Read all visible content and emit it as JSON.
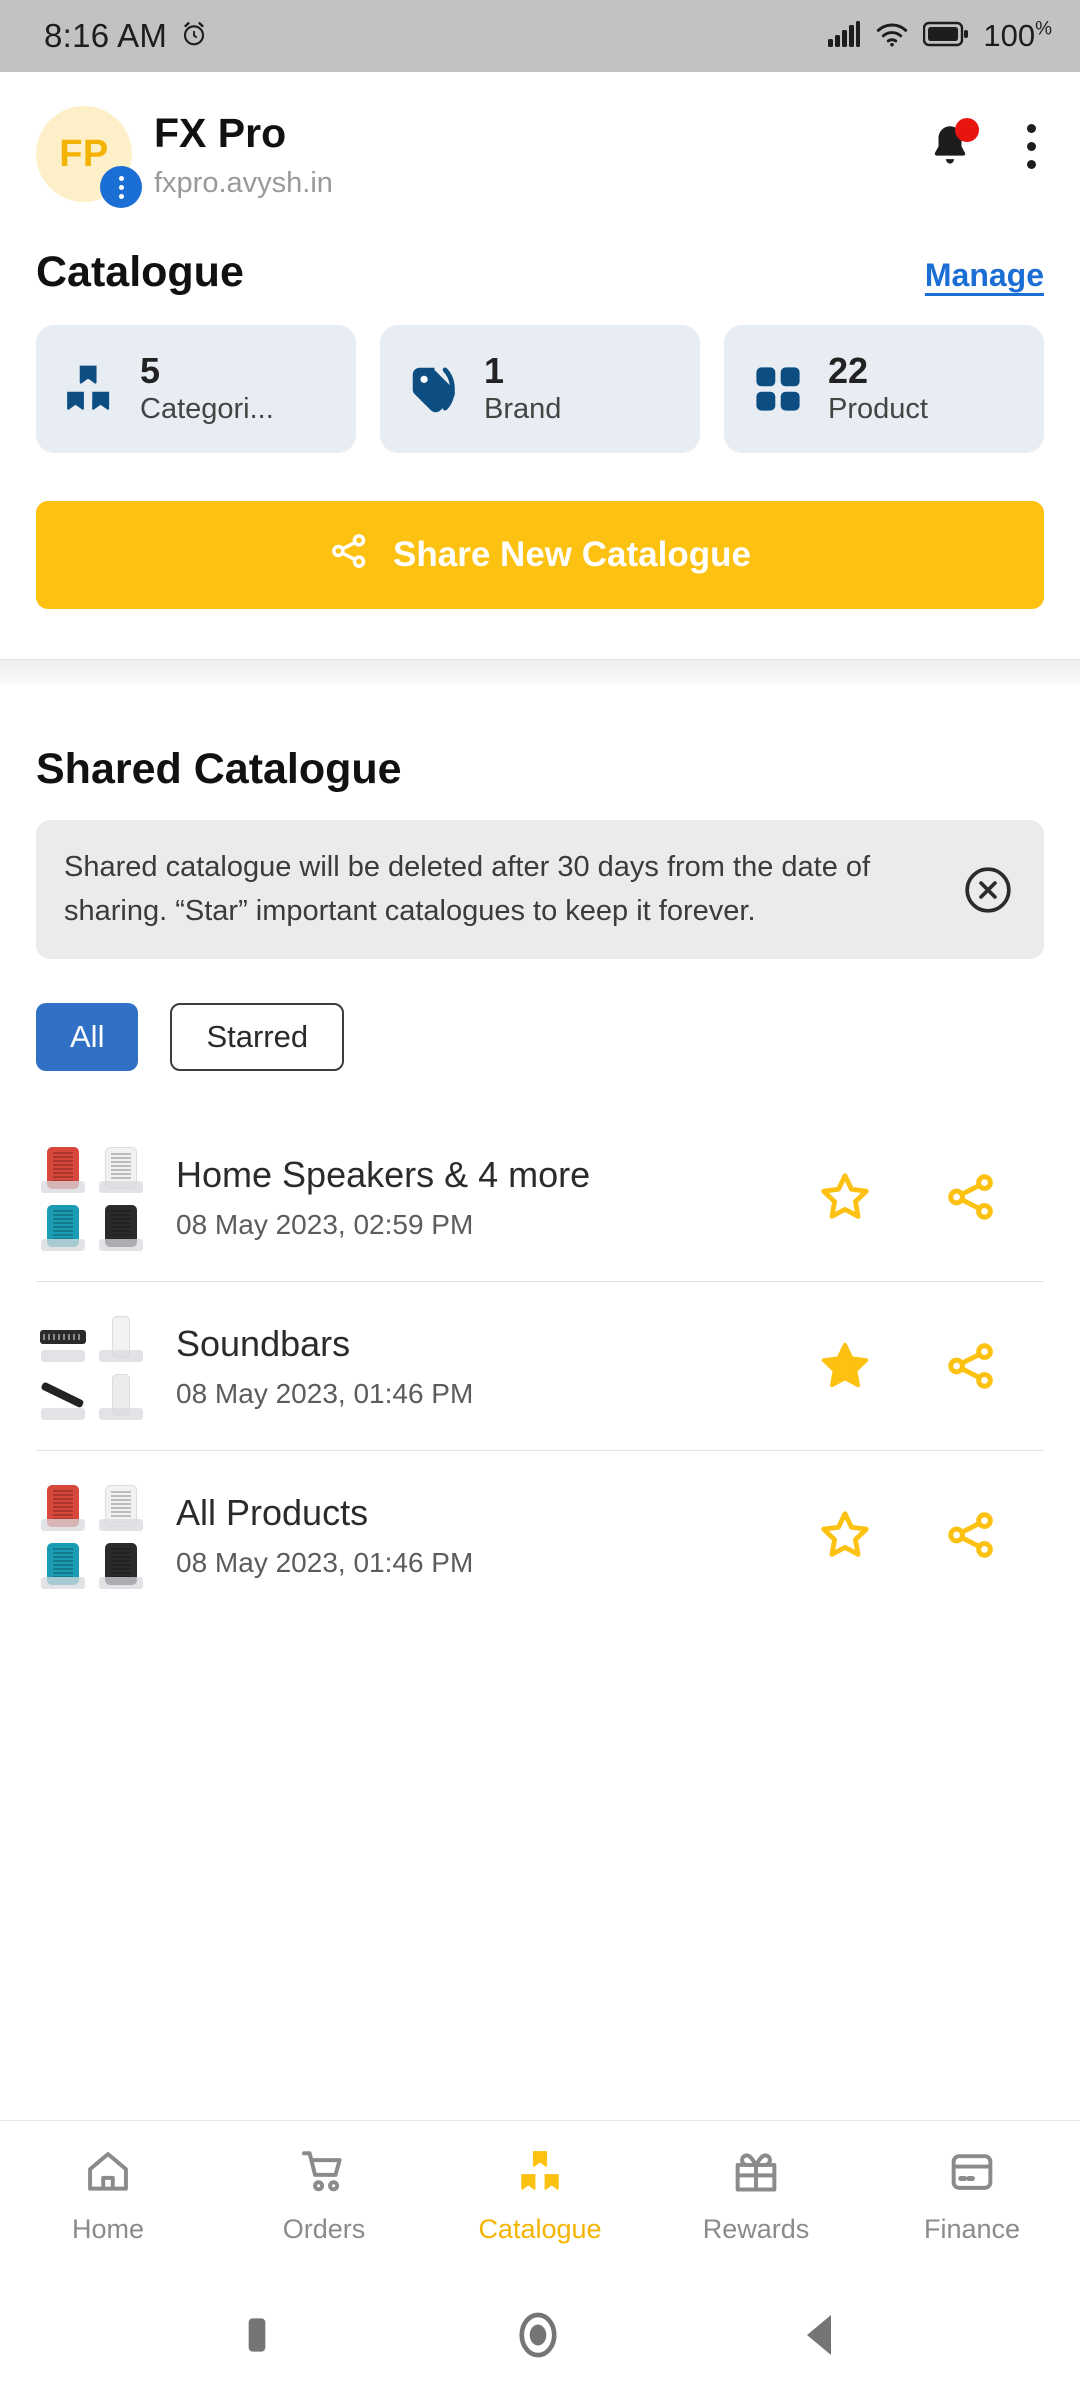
{
  "status_bar": {
    "time": "8:16 AM",
    "alarm_icon": "alarm-icon",
    "signal_icon": "cellular-signal-icon",
    "wifi_icon": "wifi-icon",
    "battery_icon": "battery-full-icon",
    "battery_text": "100",
    "battery_unit": "%"
  },
  "app_header": {
    "avatar_initials": "FP",
    "avatar_badge_icon": "more-options-badge-icon",
    "brand_name": "FX Pro",
    "brand_url": "fxpro.avysh.in",
    "notification_icon": "bell-icon",
    "overflow_icon": "kebab-menu-icon",
    "has_notification_dot": true
  },
  "catalogue": {
    "title": "Catalogue",
    "manage_label": "Manage",
    "stats": [
      {
        "value": "5",
        "label": "Categori...",
        "icon": "boxes-icon"
      },
      {
        "value": "1",
        "label": "Brand",
        "icon": "tags-icon"
      },
      {
        "value": "22",
        "label": "Product",
        "icon": "grid-squares-icon"
      }
    ],
    "share_button": {
      "label": "Share New Catalogue",
      "icon": "share-icon"
    }
  },
  "shared_catalogue": {
    "title": "Shared Catalogue",
    "notice": {
      "text": "Shared catalogue will be deleted after 30 days from the date of sharing. “Star” important catalogues to keep it forever.",
      "close_icon": "close-circle-icon"
    },
    "filters": [
      {
        "label": "All",
        "selected": true
      },
      {
        "label": "Starred",
        "selected": false
      }
    ],
    "items": [
      {
        "title": "Home Speakers & 4 more",
        "date": "08 May 2023, 02:59 PM",
        "starred": false,
        "star_icon": "star-outline-icon",
        "share_icon": "share-icon",
        "thumbnail": "speaker-grid-thumbnail"
      },
      {
        "title": "Soundbars",
        "date": "08 May 2023, 01:46 PM",
        "starred": true,
        "star_icon": "star-filled-icon",
        "share_icon": "share-icon",
        "thumbnail": "soundbar-grid-thumbnail"
      },
      {
        "title": "All Products",
        "date": "08 May 2023, 01:46 PM",
        "starred": false,
        "star_icon": "star-outline-icon",
        "share_icon": "share-icon",
        "thumbnail": "speaker-grid-thumbnail"
      }
    ]
  },
  "bottom_nav": {
    "items": [
      {
        "label": "Home",
        "icon": "home-icon",
        "active": false
      },
      {
        "label": "Orders",
        "icon": "cart-icon",
        "active": false
      },
      {
        "label": "Catalogue",
        "icon": "boxes-icon",
        "active": true
      },
      {
        "label": "Rewards",
        "icon": "gift-icon",
        "active": false
      },
      {
        "label": "Finance",
        "icon": "card-icon",
        "active": false
      }
    ]
  },
  "system_nav": {
    "recents_icon": "recents-square-icon",
    "home_icon": "home-circle-icon",
    "back_icon": "back-triangle-icon"
  },
  "colors": {
    "accent_yellow": "#fcc111",
    "accent_blue": "#1b6fd4",
    "chip_blue": "#3070c5",
    "card_bg": "#e8edf4",
    "icon_blue": "#0d4e82",
    "status_bar": "#c2c2c2",
    "notice_bg": "#ebebeb",
    "badge_red": "#e8150f"
  }
}
